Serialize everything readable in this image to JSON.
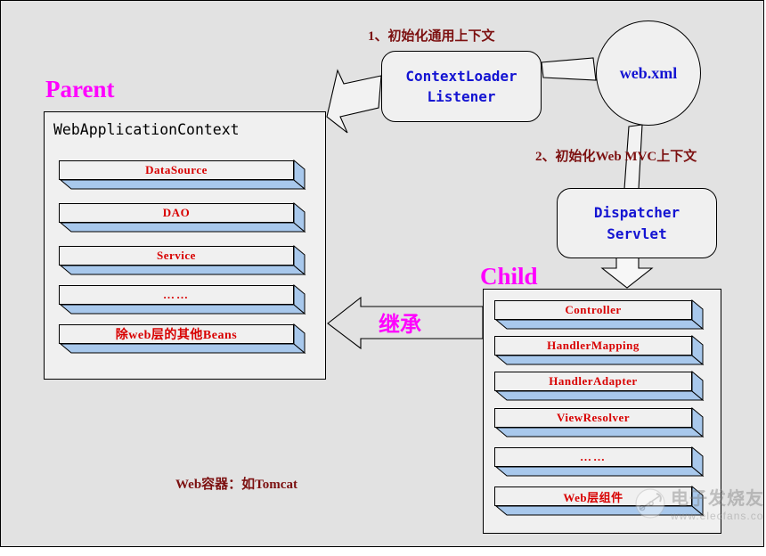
{
  "diagram": {
    "background_color": "#e2e2e2",
    "accent_magenta": "#ff00ff",
    "accent_blue": "#1414d2",
    "accent_red": "#d80000",
    "accent_darkred": "#7c1010",
    "bar_fill": "#f0f0f0",
    "bar_side": "#a8c8ec"
  },
  "steps": {
    "step1": "1、初始化通用上下文",
    "step2": "2、初始化Web MVC上下文"
  },
  "nodes": {
    "context_loader_listener": "ContextLoader\nListener",
    "web_xml": "web.xml",
    "dispatcher_servlet": "Dispatcher\nServlet"
  },
  "parent": {
    "title": "Parent",
    "caption": "WebApplicationContext",
    "beans": [
      {
        "label": "DataSource"
      },
      {
        "label": "DAO"
      },
      {
        "label": "Service"
      },
      {
        "label": "……"
      },
      {
        "label": "除web层的其他Beans"
      }
    ]
  },
  "child": {
    "title": "Child",
    "beans": [
      {
        "label": "Controller"
      },
      {
        "label": "HandlerMapping"
      },
      {
        "label": "HandlerAdapter"
      },
      {
        "label": "ViewResolver"
      },
      {
        "label": "……"
      },
      {
        "label": "Web层组件"
      }
    ]
  },
  "relations": {
    "inherit": "继承"
  },
  "footer": {
    "note": "Web容器：如Tomcat"
  },
  "watermark": {
    "main": "电子发烧友",
    "sub": "www.elecfans.com"
  }
}
